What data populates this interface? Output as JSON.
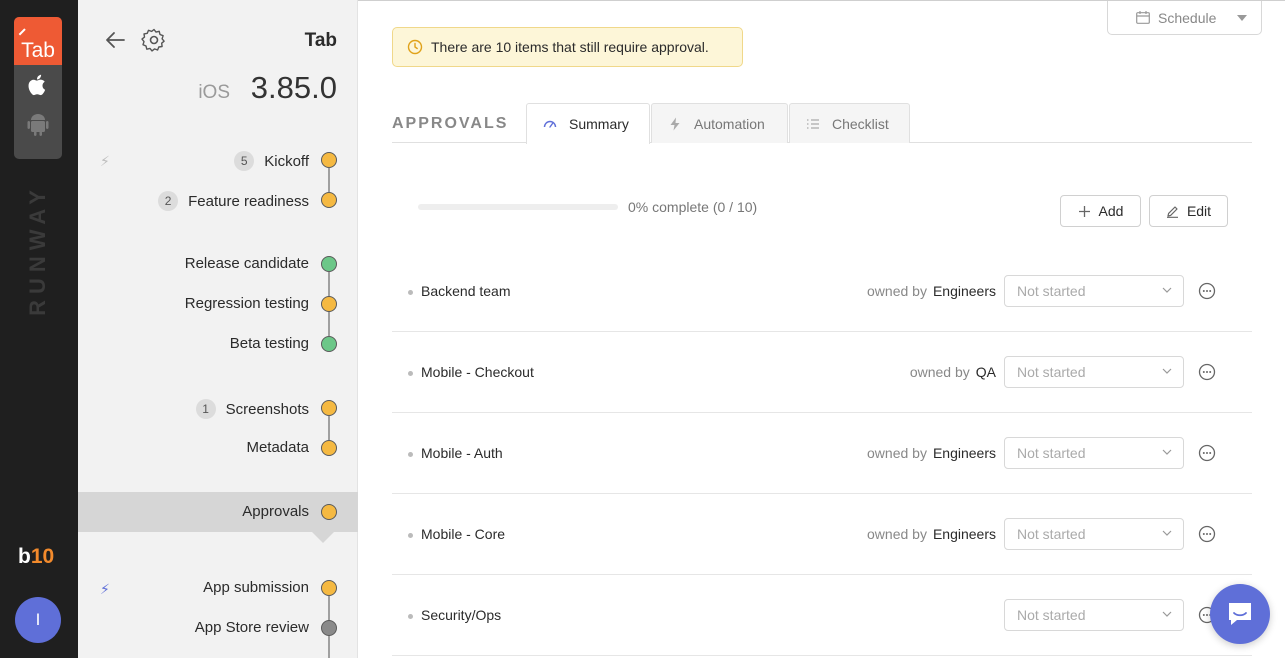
{
  "rail": {
    "app_logo_text": "Tab",
    "platforms": [
      "apple-icon",
      "android-icon"
    ],
    "brand_vertical": "RUNWAY",
    "org_badge_prefix": "b",
    "org_badge_num": "10",
    "avatar_initial": "I"
  },
  "sidebar": {
    "app_name": "Tab",
    "platform": "iOS",
    "version": "3.85.0",
    "steps": [
      {
        "label": "Kickoff",
        "count": "5",
        "status_color": "#f5b942",
        "bolt": true
      },
      {
        "label": "Feature readiness",
        "count": "2",
        "status_color": "#f5b942"
      },
      {
        "label": "Release candidate",
        "status_color": "#6cc788"
      },
      {
        "label": "Regression testing",
        "status_color": "#f5b942"
      },
      {
        "label": "Beta testing",
        "status_color": "#6cc788"
      },
      {
        "label": "Screenshots",
        "count": "1",
        "status_color": "#f5b942"
      },
      {
        "label": "Metadata",
        "status_color": "#f5b942"
      },
      {
        "label": "Approvals",
        "status_color": "#f5b942",
        "active": true
      },
      {
        "label": "App submission",
        "status_color": "#f5b942",
        "bolt": true,
        "bolt_color": "#5f6fd8"
      },
      {
        "label": "App Store review",
        "status_color": "#8a8a8a"
      }
    ]
  },
  "main": {
    "alert_text": "There are 10 items that still require approval.",
    "schedule_label": "Schedule",
    "section_title": "APPROVALS",
    "tabs": [
      {
        "label": "Summary",
        "icon": "gauge-icon",
        "active": true
      },
      {
        "label": "Automation",
        "icon": "bolt-icon"
      },
      {
        "label": "Checklist",
        "icon": "list-icon"
      }
    ],
    "progress_fraction": 0,
    "progress_text": "0% complete (0 / 10)",
    "add_label": "Add",
    "edit_label": "Edit",
    "owned_by_label": "owned by",
    "approvals": [
      {
        "name": "Backend team",
        "owner": "Engineers",
        "status": "Not started"
      },
      {
        "name": "Mobile - Checkout",
        "owner": "QA",
        "status": "Not started"
      },
      {
        "name": "Mobile - Auth",
        "owner": "Engineers",
        "status": "Not started"
      },
      {
        "name": "Mobile - Core",
        "owner": "Engineers",
        "status": "Not started"
      },
      {
        "name": "Security/Ops",
        "owner": "",
        "status": "Not started"
      }
    ]
  },
  "colors": {
    "accent": "#5f6fd8",
    "brand_orange": "#ee5a34",
    "pending": "#f5b942",
    "done": "#6cc788"
  }
}
